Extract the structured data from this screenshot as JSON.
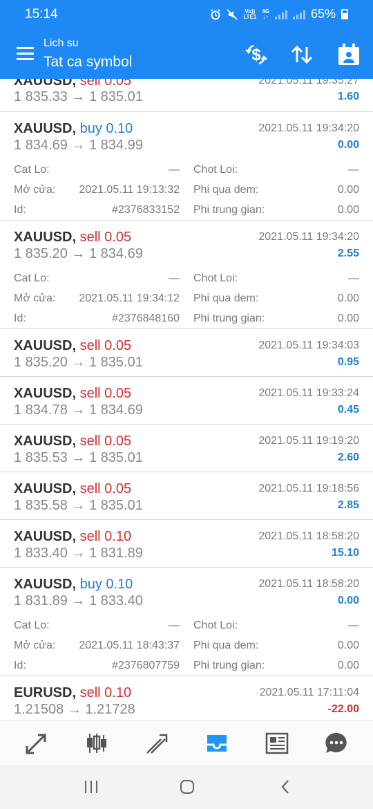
{
  "status_bar": {
    "time": "15:14",
    "battery": "65%",
    "lte_top": "Vo))",
    "lte_bottom": "LTE1",
    "net": "4G"
  },
  "app_bar": {
    "title": "Lich su",
    "subtitle": "Tat ca symbol",
    "icons": [
      "menu-icon",
      "currency-exchange-icon",
      "sort-icon",
      "calendar-icon"
    ]
  },
  "trades": [
    {
      "symbol": "XAUUSD,",
      "type": "sell 0.05",
      "side": "sell",
      "date": "2021.05.11 19:35:27",
      "prices": "1 835.33 → 1 835.01",
      "profit": "1.60"
    },
    {
      "symbol": "XAUUSD,",
      "type": "buy 0.10",
      "side": "buy",
      "date": "2021.05.11 19:34:20",
      "prices": "1 834.69 → 1 834.99",
      "profit": "0.00",
      "details": {
        "cat_lo_label": "Cat Lo:",
        "cat_lo": "—",
        "chot_loi_label": "Chot Loi:",
        "chot_loi": "—",
        "mo_cua_label": "Mở cửa:",
        "mo_cua": "2021.05.11 19:13:32",
        "phi_qua_dem_label": "Phi qua dem:",
        "phi_qua_dem": "0.00",
        "id_label": "Id:",
        "id": "#2376833152",
        "phi_trung_gian_label": "Phi trung gian:",
        "phi_trung_gian": "0.00"
      }
    },
    {
      "symbol": "XAUUSD,",
      "type": "sell 0.05",
      "side": "sell",
      "date": "2021.05.11 19:34:20",
      "prices": "1 835.20 → 1 834.69",
      "profit": "2.55",
      "details": {
        "cat_lo_label": "Cat Lo:",
        "cat_lo": "—",
        "chot_loi_label": "Chot Loi:",
        "chot_loi": "—",
        "mo_cua_label": "Mở cửa:",
        "mo_cua": "2021.05.11 19:34:12",
        "phi_qua_dem_label": "Phi qua dem:",
        "phi_qua_dem": "0.00",
        "id_label": "Id:",
        "id": "#2376848160",
        "phi_trung_gian_label": "Phi trung gian:",
        "phi_trung_gian": "0.00"
      }
    },
    {
      "symbol": "XAUUSD,",
      "type": "sell 0.05",
      "side": "sell",
      "date": "2021.05.11 19:34:03",
      "prices": "1 835.20 → 1 835.01",
      "profit": "0.95"
    },
    {
      "symbol": "XAUUSD,",
      "type": "sell 0.05",
      "side": "sell",
      "date": "2021.05.11 19:33:24",
      "prices": "1 834.78 → 1 834.69",
      "profit": "0.45"
    },
    {
      "symbol": "XAUUSD,",
      "type": "sell 0.05",
      "side": "sell",
      "date": "2021.05.11 19:19:20",
      "prices": "1 835.53 → 1 835.01",
      "profit": "2.60"
    },
    {
      "symbol": "XAUUSD,",
      "type": "sell 0.05",
      "side": "sell",
      "date": "2021.05.11 19:18:56",
      "prices": "1 835.58 → 1 835.01",
      "profit": "2.85"
    },
    {
      "symbol": "XAUUSD,",
      "type": "sell 0.10",
      "side": "sell",
      "date": "2021.05.11 18:58:20",
      "prices": "1 833.40 → 1 831.89",
      "profit": "15.10"
    },
    {
      "symbol": "XAUUSD,",
      "type": "buy 0.10",
      "side": "buy",
      "date": "2021.05.11 18:58:20",
      "prices": "1 831.89 → 1 833.40",
      "profit": "0.00",
      "details": {
        "cat_lo_label": "Cat Lo:",
        "cat_lo": "—",
        "chot_loi_label": "Chot Loi:",
        "chot_loi": "—",
        "mo_cua_label": "Mở cửa:",
        "mo_cua": "2021.05.11 18:43:37",
        "phi_qua_dem_label": "Phi qua dem:",
        "phi_qua_dem": "0.00",
        "id_label": "Id:",
        "id": "#2376807759",
        "phi_trung_gian_label": "Phi trung gian:",
        "phi_trung_gian": "0.00"
      }
    },
    {
      "symbol": "EURUSD,",
      "type": "sell 0.10",
      "side": "sell",
      "date": "2021.05.11 17:11:04",
      "prices": "1.21508 → 1.21728",
      "profit": "-22.00",
      "profit_negative": true
    }
  ],
  "bottom_nav": [
    "quotes-icon",
    "chart-icon",
    "trade-icon",
    "history-icon",
    "news-icon",
    "chat-icon"
  ],
  "active_tab": "history-icon",
  "colors": {
    "accent": "#1e88f5",
    "sell": "#d32f2f",
    "buy": "#1e7fd8",
    "active_tab": "#2196f3"
  }
}
